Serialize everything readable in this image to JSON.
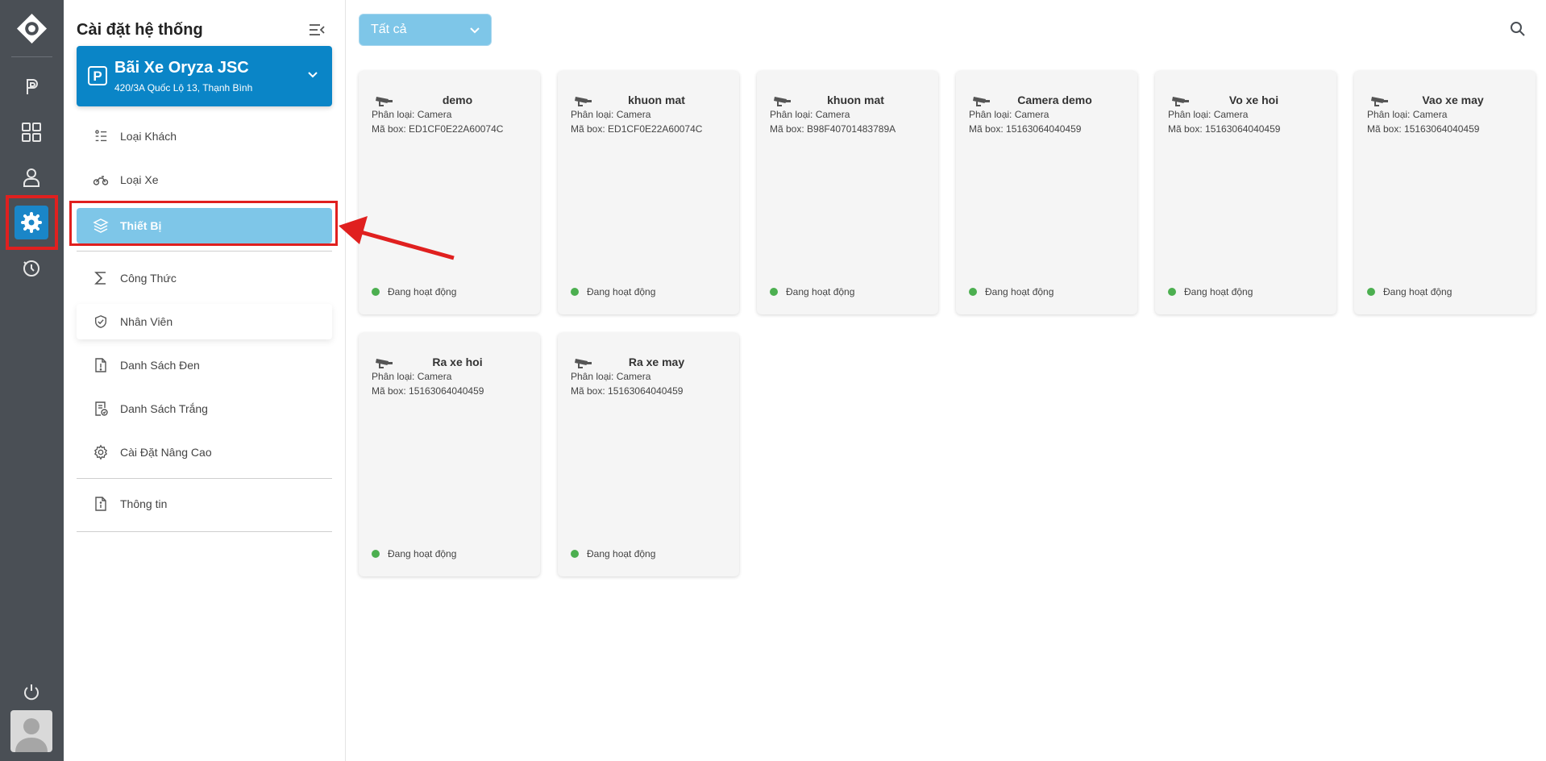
{
  "panel": {
    "title": "Cài đặt hệ thống",
    "site": {
      "name": "Bãi Xe Oryza JSC",
      "address": "420/3A Quốc Lộ 13, Thạnh Bình",
      "badge": "P"
    },
    "menu": [
      {
        "label": "Loại Khách",
        "icon": "customer-type-icon"
      },
      {
        "label": "Loại Xe",
        "icon": "motorbike-icon"
      },
      {
        "label": "Thiết Bị",
        "icon": "layers-icon",
        "active": true
      },
      {
        "label": "Công Thức",
        "icon": "sigma-icon"
      },
      {
        "label": "Nhân Viên",
        "icon": "shield-check-icon"
      },
      {
        "label": "Danh Sách Đen",
        "icon": "document-alert-icon"
      },
      {
        "label": "Danh Sách Trắng",
        "icon": "document-check-icon"
      },
      {
        "label": "Cài Đặt Nâng Cao",
        "icon": "gear-icon"
      },
      {
        "label": "Thông tin",
        "icon": "document-info-icon"
      }
    ]
  },
  "rail": {
    "items": [
      "parking-icon",
      "dashboard-grid-icon",
      "user-icon",
      "settings-icon",
      "history-icon"
    ],
    "active": "settings-icon"
  },
  "filter": {
    "selected": "Tất cả"
  },
  "devices": [
    {
      "name": "demo",
      "type": "Phân loại: Camera",
      "box": "Mã box: ED1CF0E22A60074C",
      "status": "Đang hoạt động"
    },
    {
      "name": "khuon mat",
      "type": "Phân loại: Camera",
      "box": "Mã box: ED1CF0E22A60074C",
      "status": "Đang hoạt động"
    },
    {
      "name": "khuon mat",
      "type": "Phân loại: Camera",
      "box": "Mã box: B98F40701483789A",
      "status": "Đang hoạt động"
    },
    {
      "name": "Camera demo",
      "type": "Phân loại: Camera",
      "box": "Mã box: 15163064040459",
      "status": "Đang hoạt động"
    },
    {
      "name": "Vo xe hoi",
      "type": "Phân loại: Camera",
      "box": "Mã box: 15163064040459",
      "status": "Đang hoạt động"
    },
    {
      "name": "Vao xe may",
      "type": "Phân loại: Camera",
      "box": "Mã box: 15163064040459",
      "status": "Đang hoạt động"
    },
    {
      "name": "Ra xe hoi",
      "type": "Phân loại: Camera",
      "box": "Mã box: 15163064040459",
      "status": "Đang hoạt động"
    },
    {
      "name": "Ra xe may",
      "type": "Phân loại: Camera",
      "box": "Mã box: 15163064040459",
      "status": "Đang hoạt động"
    }
  ],
  "colors": {
    "rail": "#4a4f55",
    "accent": "#0a85c7",
    "active_item": "#7ec6e8",
    "highlight": "#e0201f",
    "status_ok": "#4caf50"
  }
}
